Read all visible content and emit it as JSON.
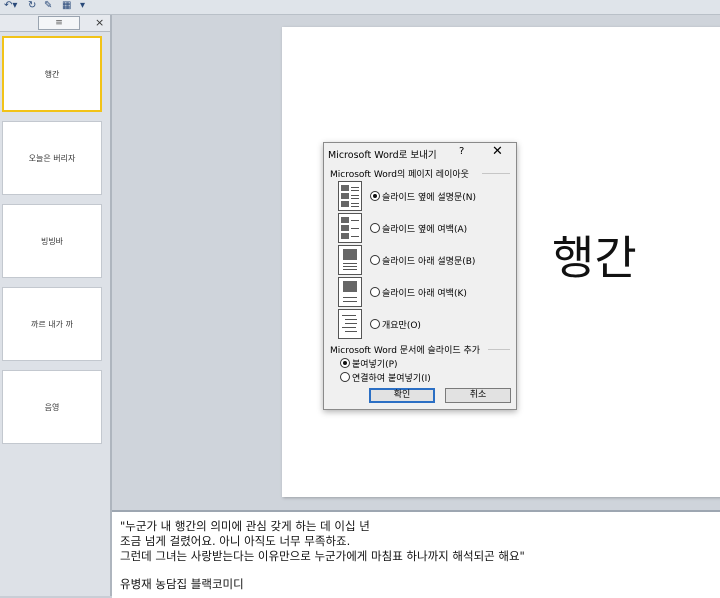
{
  "qat": {
    "icons": [
      "undo-icon",
      "redo-icon",
      "spell-check-icon",
      "slide-layout-icon",
      "customize-icon"
    ]
  },
  "panel": {
    "tab_outline_glyph": "≡",
    "close_glyph": "×"
  },
  "thumbnails": [
    {
      "label": "행간"
    },
    {
      "label": "오늘은 버리자"
    },
    {
      "label": "빙빙바"
    },
    {
      "label": "까르 내가 까"
    },
    {
      "label": "음영"
    }
  ],
  "slide": {
    "title": "행간"
  },
  "notes": {
    "lines": [
      "\"누군가 내 행간의 의미에 관심 갖게 하는 데 이십 년",
      "조금 넘게 걸렸어요. 아니 아직도 너무 무족하죠.",
      "그런데 그녀는 사랑받는다는 이유만으로 누군가에게 마침표 하나까지 해석되곤 해요\"",
      "",
      "유병재 농담집 블랙코미디"
    ]
  },
  "dialog": {
    "title": "Microsoft Word로 보내기",
    "help": "?",
    "close": "✕",
    "layout_group": "Microsoft Word의 페이지 레이아웃",
    "layout_options": [
      {
        "label": "슬라이드 옆에 설명문(N)",
        "selected": true
      },
      {
        "label": "슬라이드 옆에 여백(A)",
        "selected": false
      },
      {
        "label": "슬라이드 아래 설명문(B)",
        "selected": false
      },
      {
        "label": "슬라이드 아래 여백(K)",
        "selected": false
      },
      {
        "label": "개요만(O)",
        "selected": false
      }
    ],
    "add_group": "Microsoft Word 문서에 슬라이드 추가",
    "add_options": [
      {
        "label": "붙여넣기(P)",
        "selected": true
      },
      {
        "label": "연결하여 붙여넣기(I)",
        "selected": false
      }
    ],
    "ok": "확인",
    "cancel": "취소"
  }
}
